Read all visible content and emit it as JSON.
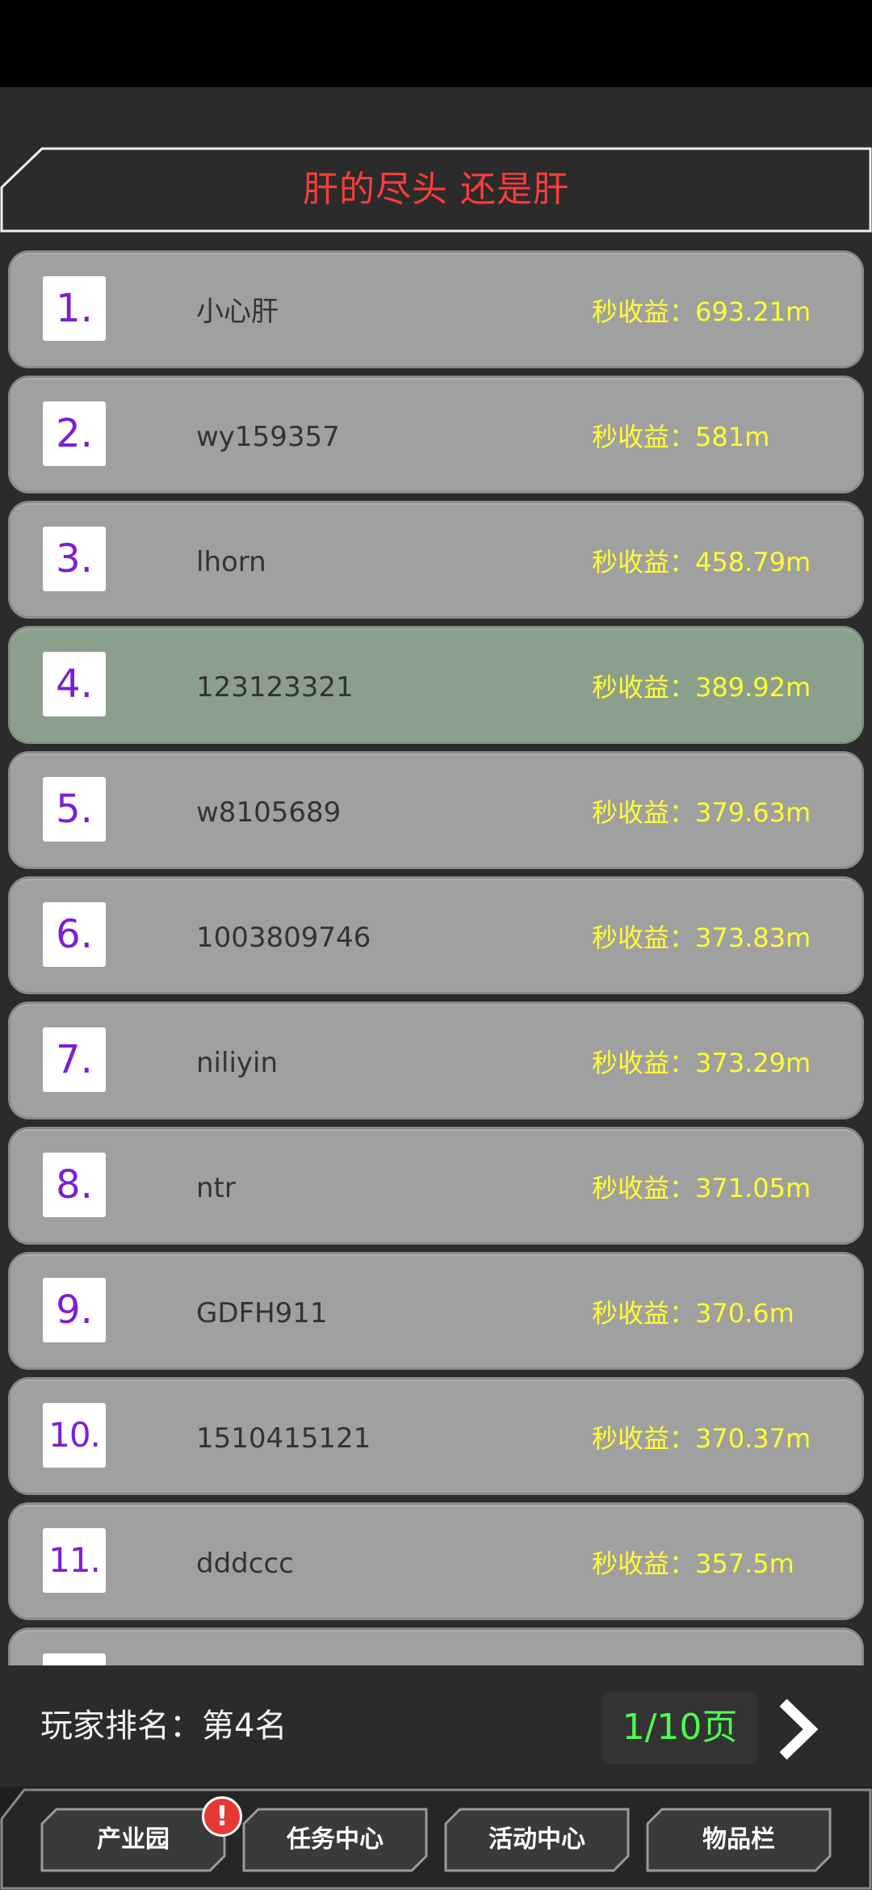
{
  "header": {
    "title": "肝的尽头 还是肝"
  },
  "leaderboard": {
    "rows": [
      {
        "rank": "1.",
        "name": "小心肝",
        "income": "秒收益：693.21m",
        "highlight": false
      },
      {
        "rank": "2.",
        "name": "wy159357",
        "income": "秒收益：581m",
        "highlight": false
      },
      {
        "rank": "3.",
        "name": "lhorn",
        "income": "秒收益：458.79m",
        "highlight": false
      },
      {
        "rank": "4.",
        "name": "123123321",
        "income": "秒收益：389.92m",
        "highlight": true
      },
      {
        "rank": "5.",
        "name": "w8105689",
        "income": "秒收益：379.63m",
        "highlight": false
      },
      {
        "rank": "6.",
        "name": "1003809746",
        "income": "秒收益：373.83m",
        "highlight": false
      },
      {
        "rank": "7.",
        "name": "niliyin",
        "income": "秒收益：373.29m",
        "highlight": false
      },
      {
        "rank": "8.",
        "name": "ntr",
        "income": "秒收益：371.05m",
        "highlight": false
      },
      {
        "rank": "9.",
        "name": "GDFH911",
        "income": "秒收益：370.6m",
        "highlight": false
      },
      {
        "rank": "10.",
        "name": "1510415121",
        "income": "秒收益：370.37m",
        "highlight": false
      },
      {
        "rank": "11.",
        "name": "dddccc",
        "income": "秒收益：357.5m",
        "highlight": false
      },
      {
        "rank": "",
        "name": "",
        "income": "",
        "highlight": false
      }
    ]
  },
  "footer": {
    "player_rank": "玩家排名：第4名",
    "page": "1/10页",
    "next_icon": "chevron-right-icon"
  },
  "nav": {
    "items": [
      {
        "label": "产业园",
        "badge": "!"
      },
      {
        "label": "任务中心"
      },
      {
        "label": "活动中心"
      },
      {
        "label": "物品栏"
      }
    ]
  },
  "colors": {
    "title": "#ff3b3b",
    "rank": "#7b1fd6",
    "income": "#ffff33",
    "page": "#4cff4c",
    "row": "#a0a0a0",
    "row_highlight": "#8c9f8c"
  }
}
